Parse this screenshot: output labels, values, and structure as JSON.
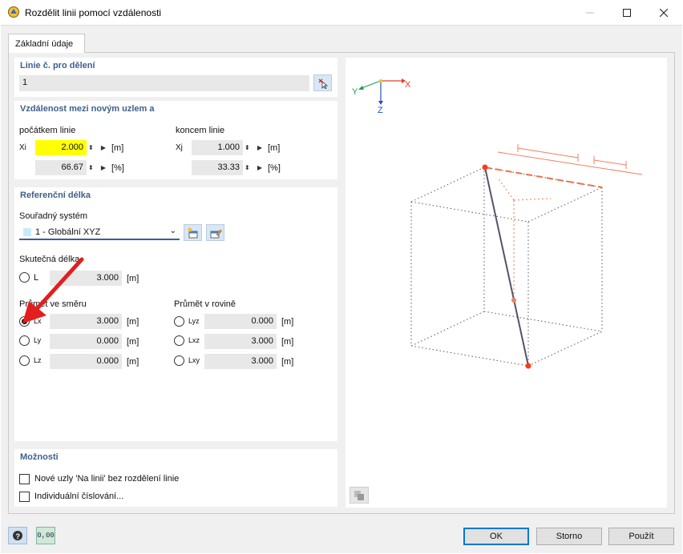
{
  "window": {
    "title": "Rozdělit linii pomocí vzdálenosti"
  },
  "tabs": [
    {
      "label": "Základní údaje"
    }
  ],
  "line_group": {
    "title": "Linie č. pro dělení",
    "value": "1"
  },
  "distance_group": {
    "title": "Vzdálenost mezi novým uzlem a",
    "start_label": "počátkem linie",
    "end_label": "koncem linie",
    "xi_label": "Xi",
    "xi_value": "2.000",
    "xi_unit": "[m]",
    "xi_pct_value": "66.67",
    "xi_pct_unit": "[%]",
    "xj_label": "Xj",
    "xj_value": "1.000",
    "xj_unit": "[m]",
    "xj_pct_value": "33.33",
    "xj_pct_unit": "[%]"
  },
  "reference_group": {
    "title": "Referenční délka",
    "cs_label": "Souřadný systém",
    "cs_value": "1 - Globální XYZ",
    "actual_length_label": "Skutečná délka",
    "L": {
      "label": "L",
      "value": "3.000",
      "unit": "[m]"
    },
    "direction_label": "Průmět ve směru",
    "plane_label": "Průmět v rovině",
    "Lx": {
      "label": "Lx",
      "value": "3.000",
      "unit": "[m]"
    },
    "Ly": {
      "label": "Ly",
      "value": "0.000",
      "unit": "[m]"
    },
    "Lz": {
      "label": "Lz",
      "value": "0.000",
      "unit": "[m]"
    },
    "Lyz": {
      "label": "Lyz",
      "value": "0.000",
      "unit": "[m]"
    },
    "Lxz": {
      "label": "Lxz",
      "value": "3.000",
      "unit": "[m]"
    },
    "Lxy": {
      "label": "Lxy",
      "value": "3.000",
      "unit": "[m]"
    },
    "selected": "Lx"
  },
  "options_group": {
    "title": "Možnosti",
    "opt1": "Nové uzly 'Na linii' bez rozdělení linie",
    "opt2": "Individuální číslování..."
  },
  "axes": {
    "x": "X",
    "y": "Y",
    "z": "Z"
  },
  "footer": {
    "ok": "OK",
    "cancel": "Storno",
    "apply": "Použít",
    "units_icon": "0,00"
  },
  "colors": {
    "accent": "#3f5f8c",
    "highlight": "#ffff00",
    "node": "#ff4422",
    "dim_line": "#f08060"
  }
}
